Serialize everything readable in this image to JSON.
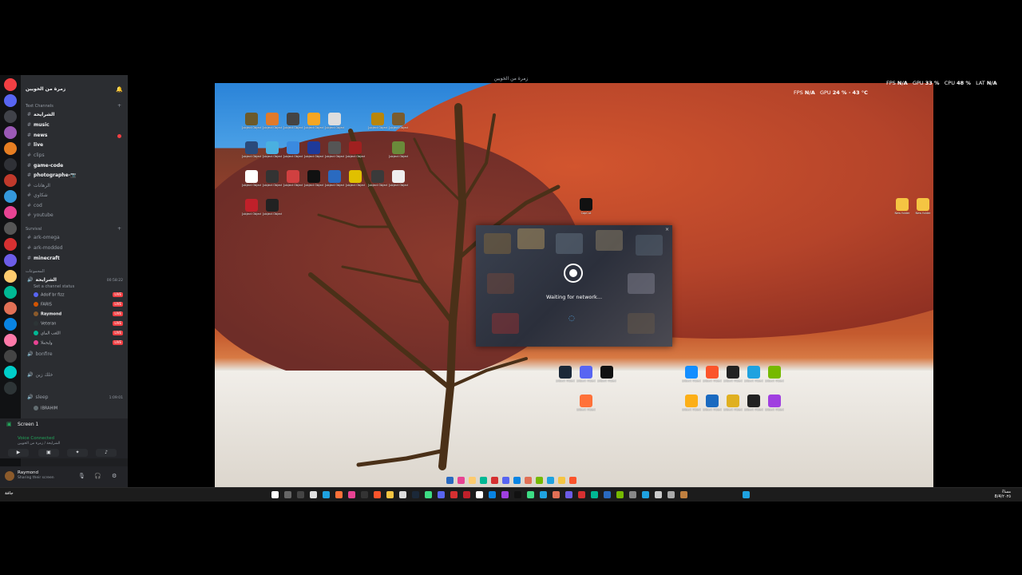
{
  "window": {
    "title": "زمرة من الخويين"
  },
  "discord": {
    "server_name": "زمرة من الخويين",
    "categories": {
      "text": "Text Channels",
      "survival": "Survival",
      "voice": "المجموعات"
    },
    "text_channels": [
      {
        "name": "الشرايحة",
        "bright": true
      },
      {
        "name": "music",
        "bright": true
      },
      {
        "name": "news",
        "bright": true
      },
      {
        "name": "live",
        "bright": true
      },
      {
        "name": "clips",
        "bright": false
      },
      {
        "name": "game-code",
        "bright": true
      },
      {
        "name": "photographe-📷",
        "bright": true
      },
      {
        "name": "الرهانات",
        "bright": false
      },
      {
        "name": "شكاوي",
        "bright": false
      },
      {
        "name": "cod",
        "bright": false
      },
      {
        "name": "youtube",
        "bright": false
      }
    ],
    "survival_channels": [
      {
        "name": "ark-omega",
        "bright": false
      },
      {
        "name": "ark-modded",
        "bright": false
      },
      {
        "name": "minecraft",
        "bright": true
      }
    ],
    "voice_channel": {
      "name": "الشرايحة",
      "timer": "00:58:22",
      "status_hint": "Set a channel status",
      "users": [
        {
          "name": "Adolf br fizz",
          "live": true
        },
        {
          "name": "FARIS",
          "live": true
        },
        {
          "name": "Raymond",
          "live": true
        },
        {
          "name": "Veteran",
          "live": true
        },
        {
          "name": "اللعب الماي",
          "live": true
        },
        {
          "name": "وليجملا",
          "live": true
        }
      ]
    },
    "bonfire": {
      "name": "bonfire"
    },
    "other_voice": [
      {
        "name": "خلك زين"
      },
      {
        "name": "sleep",
        "timer": "1:09:01"
      }
    ],
    "sleep_user": "IBRAHIM",
    "screen_panel": {
      "label": "Screen 1",
      "vc_title": "Voice Connected",
      "vc_sub": "الشرايحة / زمرة من الخويين"
    },
    "user": {
      "name": "Raymond",
      "status": "Sharing their screen"
    }
  },
  "desktop": {
    "overlay": {
      "fps_label": "FPS",
      "fps": "N/A",
      "gpu_label": "GPU",
      "gpu": "24 % · 43 °C"
    },
    "icons": [
      {
        "label": "Escape the Backrooms",
        "color": "#6b5a2b"
      },
      {
        "label": "FireFl...",
        "color": "#e07a2a"
      },
      {
        "label": "September 7th",
        "color": "#444"
      },
      {
        "label": "Overwatch",
        "color": "#f5a623"
      },
      {
        "label": "Goose Goose Duck",
        "color": "#ddd"
      },
      {
        "label": "BACKROOMS...",
        "color": "#b8860b"
      },
      {
        "label": "Grounded",
        "color": "#7a5c2e"
      },
      {
        "label": "Ghostrunner",
        "color": "#2a4a7a"
      },
      {
        "label": "Palworld",
        "color": "#4ab0e0"
      },
      {
        "label": "Fortnite",
        "color": "#3a8ae0"
      },
      {
        "label": "Backrooms Escape To...",
        "color": "#1e3a9a"
      },
      {
        "label": "SCENT HILL 2",
        "color": "#555"
      },
      {
        "label": "Kingdom Come",
        "color": "#a02020"
      },
      {
        "label": "Grand Theft Auto",
        "color": "#6a8a3a"
      },
      {
        "label": "GitHub",
        "color": "#fff"
      },
      {
        "label": "PARADOX",
        "color": "#333"
      },
      {
        "label": "RV There Yet",
        "color": "#d04040"
      },
      {
        "label": "Chromatic",
        "color": "#111"
      },
      {
        "label": "Portal 2",
        "color": "#2a6ac0"
      },
      {
        "label": "DONT SCREAM",
        "color": "#e0c000"
      },
      {
        "label": "Dead Rail",
        "color": "#3a3a3a"
      },
      {
        "label": "Overwatch 2",
        "color": "#eee"
      },
      {
        "label": "Opera GX Browser",
        "color": "#c0202a"
      },
      {
        "label": "Roblox Studio",
        "color": "#222"
      }
    ],
    "icon_capcut": "CapCut",
    "mid_icons": [
      {
        "label": "Steam",
        "color": "#1b2838"
      },
      {
        "label": "Discord",
        "color": "#5865f2"
      },
      {
        "label": "Medal",
        "color": "#111"
      },
      {
        "label": "Firefox",
        "color": "#ff7139"
      }
    ],
    "right_icons": [
      {
        "label": "Battle.net",
        "color": "#148eff"
      },
      {
        "label": "Brave",
        "color": "#fb542b"
      },
      {
        "label": "SignalRGB",
        "color": "#222"
      },
      {
        "label": "Microsoft Edge",
        "color": "#1fa2e0"
      },
      {
        "label": "NVIDIA App",
        "color": "#76b900"
      },
      {
        "label": "Rockstar Games",
        "color": "#fcaf17"
      },
      {
        "label": "Wallpaper Engine",
        "color": "#1a6ac0"
      },
      {
        "label": "Ghost MaxTERMS",
        "color": "#e0b020"
      },
      {
        "label": "Epic Games Launcher",
        "color": "#222"
      },
      {
        "label": "Wand Modded",
        "color": "#a040e0"
      }
    ],
    "folder_icons": [
      "New folder",
      "New folder"
    ],
    "steam": {
      "status": "Waiting for network..."
    }
  },
  "host": {
    "fps_label": "FPS",
    "fps": "N/A",
    "gpu_label": "GPU",
    "gpu": "33 %",
    "cpu_label": "CPU",
    "cpu": "48 %",
    "lat_label": "LAT",
    "lat": "N/A"
  },
  "taskbar": {
    "left_text": "جافة",
    "clock_time": "مساءً",
    "clock_date": "8/4/٢٠٢٥"
  }
}
